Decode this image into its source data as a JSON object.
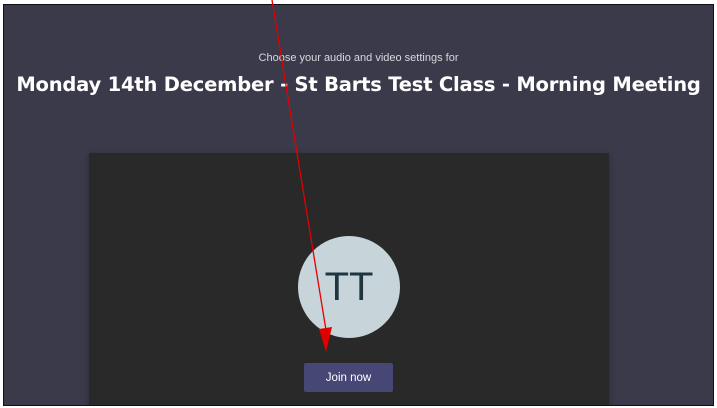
{
  "prejoin": {
    "subtitle": "Choose your audio and video settings for",
    "meeting_title": "Monday 14th December - St Barts Test Class - Morning Meeting"
  },
  "preview": {
    "avatar_initials": "TT",
    "avatar_color": "#c7d5db"
  },
  "actions": {
    "join_label": "Join now",
    "join_color": "#464775"
  },
  "annotation": {
    "type": "arrow",
    "color": "#e00000",
    "points_to": "join-button"
  }
}
